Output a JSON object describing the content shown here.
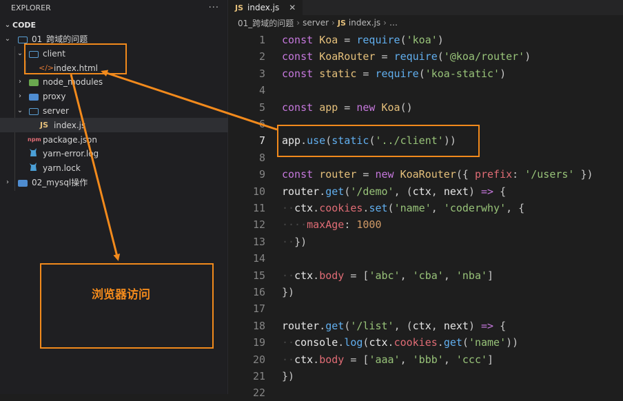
{
  "sidebar": {
    "title": "EXPLORER",
    "more_glyph": "···",
    "section": "CODE",
    "items": [
      {
        "label": "01_跨域的问题",
        "kind": "folder-open"
      },
      {
        "label": "client",
        "kind": "folder-open"
      },
      {
        "label": "index.html",
        "kind": "html-file",
        "icon_glyph": "</>"
      },
      {
        "label": "node_modules",
        "kind": "folder-closed"
      },
      {
        "label": "proxy",
        "kind": "folder-closed"
      },
      {
        "label": "server",
        "kind": "folder-open"
      },
      {
        "label": "index.js",
        "kind": "js-file",
        "icon_glyph": "JS"
      },
      {
        "label": "package.json",
        "kind": "npm-file",
        "icon_glyph": "npm"
      },
      {
        "label": "yarn-error.log",
        "kind": "yarn-file"
      },
      {
        "label": "yarn.lock",
        "kind": "yarn-file"
      },
      {
        "label": "02_mysql操作",
        "kind": "folder-closed"
      }
    ]
  },
  "editor": {
    "tab": {
      "badge": "JS",
      "label": "index.js",
      "close_glyph": "✕"
    },
    "breadcrumbs": [
      "01_跨域的问题",
      "server",
      "JS",
      "index.js",
      "…"
    ],
    "active_line": 7,
    "lines": [
      {
        "n": "1",
        "tokens": [
          [
            "kw",
            "const"
          ],
          [
            "pn",
            " "
          ],
          [
            "var",
            "Koa"
          ],
          [
            "pn",
            " = "
          ],
          [
            "fn",
            "require"
          ],
          [
            "pn",
            "("
          ],
          [
            "str",
            "'koa'"
          ],
          [
            "pn",
            ")"
          ]
        ]
      },
      {
        "n": "2",
        "tokens": [
          [
            "kw",
            "const"
          ],
          [
            "pn",
            " "
          ],
          [
            "var",
            "KoaRouter"
          ],
          [
            "pn",
            " = "
          ],
          [
            "fn",
            "require"
          ],
          [
            "pn",
            "("
          ],
          [
            "str",
            "'@koa/router'"
          ],
          [
            "pn",
            ")"
          ]
        ]
      },
      {
        "n": "3",
        "tokens": [
          [
            "kw",
            "const"
          ],
          [
            "pn",
            " "
          ],
          [
            "var",
            "static"
          ],
          [
            "pn",
            " = "
          ],
          [
            "fn",
            "require"
          ],
          [
            "pn",
            "("
          ],
          [
            "str",
            "'koa-static'"
          ],
          [
            "pn",
            ")"
          ]
        ]
      },
      {
        "n": "4",
        "tokens": []
      },
      {
        "n": "5",
        "tokens": [
          [
            "kw",
            "const"
          ],
          [
            "pn",
            " "
          ],
          [
            "var",
            "app"
          ],
          [
            "pn",
            " = "
          ],
          [
            "kw",
            "new"
          ],
          [
            "pn",
            " "
          ],
          [
            "var",
            "Koa"
          ],
          [
            "pn",
            "()"
          ]
        ]
      },
      {
        "n": "6",
        "tokens": []
      },
      {
        "n": "7",
        "tokens": [
          [
            "plain",
            "app"
          ],
          [
            "pn",
            "."
          ],
          [
            "fn",
            "use"
          ],
          [
            "pn",
            "("
          ],
          [
            "fn",
            "static"
          ],
          [
            "pn",
            "("
          ],
          [
            "str",
            "'../client'"
          ],
          [
            "pn",
            "))"
          ]
        ]
      },
      {
        "n": "8",
        "tokens": []
      },
      {
        "n": "9",
        "tokens": [
          [
            "kw",
            "const"
          ],
          [
            "pn",
            " "
          ],
          [
            "var",
            "router"
          ],
          [
            "pn",
            " = "
          ],
          [
            "kw",
            "new"
          ],
          [
            "pn",
            " "
          ],
          [
            "var",
            "KoaRouter"
          ],
          [
            "pn",
            "({ "
          ],
          [
            "prop",
            "prefix"
          ],
          [
            "pn",
            ": "
          ],
          [
            "str",
            "'/users'"
          ],
          [
            "pn",
            " })"
          ]
        ]
      },
      {
        "n": "10",
        "tokens": [
          [
            "plain",
            "router"
          ],
          [
            "pn",
            "."
          ],
          [
            "fn",
            "get"
          ],
          [
            "pn",
            "("
          ],
          [
            "str",
            "'/demo'"
          ],
          [
            "pn",
            ", ("
          ],
          [
            "plain",
            "ctx"
          ],
          [
            "pn",
            ", "
          ],
          [
            "plain",
            "next"
          ],
          [
            "pn",
            ") "
          ],
          [
            "kw",
            "=>"
          ],
          [
            "pn",
            " {"
          ]
        ]
      },
      {
        "n": "11",
        "tokens": [
          [
            "ws",
            "··"
          ],
          [
            "plain",
            "ctx"
          ],
          [
            "pn",
            "."
          ],
          [
            "prop",
            "cookies"
          ],
          [
            "pn",
            "."
          ],
          [
            "fn",
            "set"
          ],
          [
            "pn",
            "("
          ],
          [
            "str",
            "'name'"
          ],
          [
            "pn",
            ", "
          ],
          [
            "str",
            "'coderwhy'"
          ],
          [
            "pn",
            ", {"
          ]
        ]
      },
      {
        "n": "12",
        "tokens": [
          [
            "ws",
            "····"
          ],
          [
            "prop",
            "maxAge"
          ],
          [
            "pn",
            ": "
          ],
          [
            "num",
            "1000"
          ]
        ]
      },
      {
        "n": "13",
        "tokens": [
          [
            "ws",
            "··"
          ],
          [
            "pn",
            "})"
          ]
        ]
      },
      {
        "n": "14",
        "tokens": []
      },
      {
        "n": "15",
        "tokens": [
          [
            "ws",
            "··"
          ],
          [
            "plain",
            "ctx"
          ],
          [
            "pn",
            "."
          ],
          [
            "prop",
            "body"
          ],
          [
            "pn",
            " = ["
          ],
          [
            "str",
            "'abc'"
          ],
          [
            "pn",
            ", "
          ],
          [
            "str",
            "'cba'"
          ],
          [
            "pn",
            ", "
          ],
          [
            "str",
            "'nba'"
          ],
          [
            "pn",
            "]"
          ]
        ]
      },
      {
        "n": "16",
        "tokens": [
          [
            "pn",
            "})"
          ]
        ]
      },
      {
        "n": "17",
        "tokens": []
      },
      {
        "n": "18",
        "tokens": [
          [
            "plain",
            "router"
          ],
          [
            "pn",
            "."
          ],
          [
            "fn",
            "get"
          ],
          [
            "pn",
            "("
          ],
          [
            "str",
            "'/list'"
          ],
          [
            "pn",
            ", ("
          ],
          [
            "plain",
            "ctx"
          ],
          [
            "pn",
            ", "
          ],
          [
            "plain",
            "next"
          ],
          [
            "pn",
            ") "
          ],
          [
            "kw",
            "=>"
          ],
          [
            "pn",
            " {"
          ]
        ]
      },
      {
        "n": "19",
        "tokens": [
          [
            "ws",
            "··"
          ],
          [
            "plain",
            "console"
          ],
          [
            "pn",
            "."
          ],
          [
            "fn",
            "log"
          ],
          [
            "pn",
            "("
          ],
          [
            "plain",
            "ctx"
          ],
          [
            "pn",
            "."
          ],
          [
            "prop",
            "cookies"
          ],
          [
            "pn",
            "."
          ],
          [
            "fn",
            "get"
          ],
          [
            "pn",
            "("
          ],
          [
            "str",
            "'name'"
          ],
          [
            "pn",
            "))"
          ]
        ]
      },
      {
        "n": "20",
        "tokens": [
          [
            "ws",
            "··"
          ],
          [
            "plain",
            "ctx"
          ],
          [
            "pn",
            "."
          ],
          [
            "prop",
            "body"
          ],
          [
            "pn",
            " = ["
          ],
          [
            "str",
            "'aaa'"
          ],
          [
            "pn",
            ", "
          ],
          [
            "str",
            "'bbb'"
          ],
          [
            "pn",
            ", "
          ],
          [
            "str",
            "'ccc'"
          ],
          [
            "pn",
            "]"
          ]
        ]
      },
      {
        "n": "21",
        "tokens": [
          [
            "pn",
            "})"
          ]
        ]
      },
      {
        "n": "22",
        "tokens": []
      }
    ]
  },
  "annotation": {
    "label": "浏览器访问",
    "color": "#f28a1c"
  }
}
